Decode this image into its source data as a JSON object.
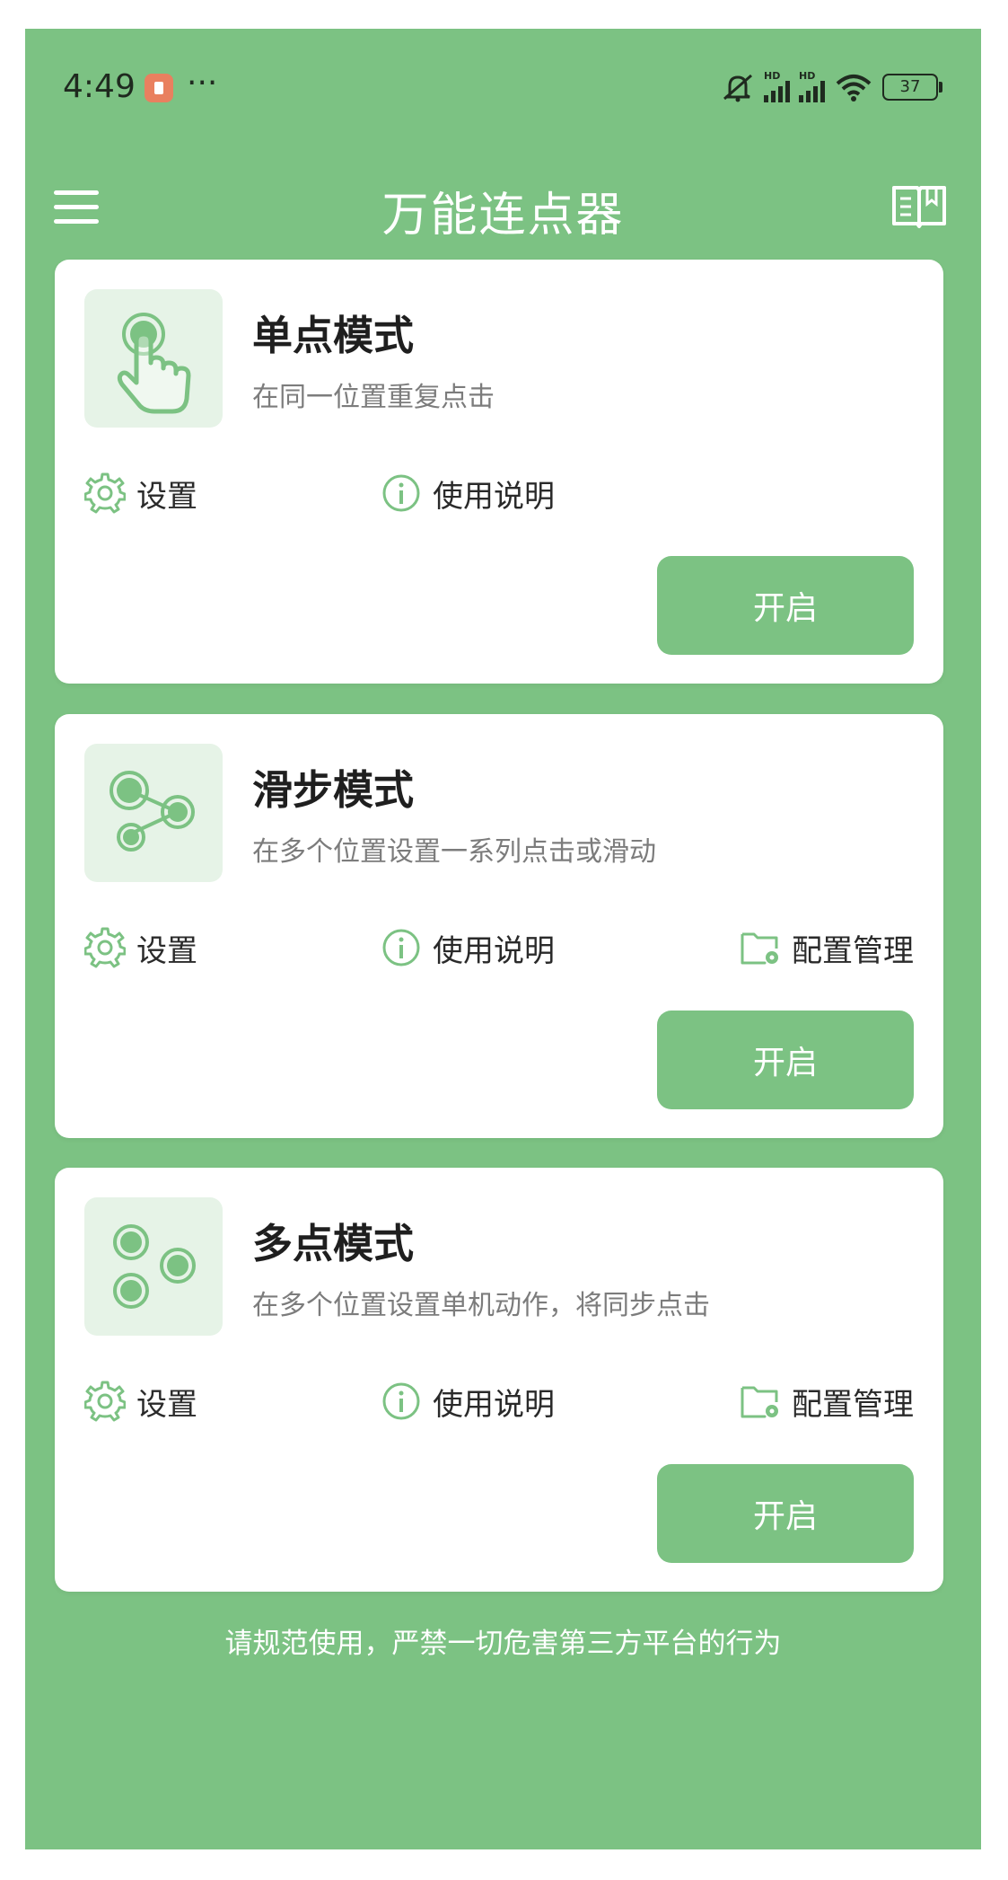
{
  "status_bar": {
    "time": "4:49",
    "dots": "···",
    "battery": "37"
  },
  "app_bar": {
    "title": "万能连点器"
  },
  "cards": [
    {
      "name": "单点模式",
      "desc": "在同一位置重复点击",
      "settings": "设置",
      "help": "使用说明",
      "start": "开启"
    },
    {
      "name": "滑步模式",
      "desc": "在多个位置设置一系列点击或滑动",
      "settings": "设置",
      "help": "使用说明",
      "config": "配置管理",
      "start": "开启"
    },
    {
      "name": "多点模式",
      "desc": "在多个位置设置单机动作，将同步点击",
      "settings": "设置",
      "help": "使用说明",
      "config": "配置管理",
      "start": "开启"
    }
  ],
  "footer": {
    "note": "请规范使用，严禁一切危害第三方平台的行为"
  },
  "colors": {
    "primary": "#7cc283",
    "icon_bg": "#e6f3e7",
    "text": "#1f1f1f",
    "subtext": "#7c7c7c"
  },
  "icons": [
    "menu-icon",
    "book-icon",
    "gear-icon",
    "info-icon",
    "folder-gear-icon",
    "tap-hand-icon",
    "swipe-nodes-icon",
    "multi-dots-icon"
  ]
}
